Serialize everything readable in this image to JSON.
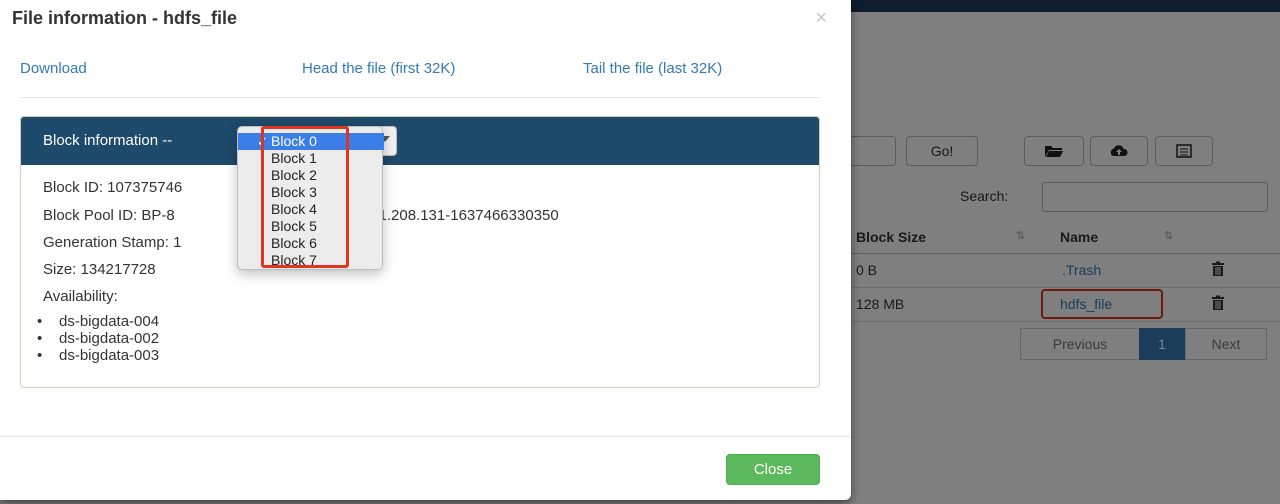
{
  "background": {
    "go_button": "Go!",
    "search_label": "Search:",
    "table": {
      "headers": [
        "Block Size",
        "Name"
      ],
      "rows": [
        {
          "block_size": "0 B",
          "name": ".Trash"
        },
        {
          "block_size": "128 MB",
          "name": "hdfs_file"
        }
      ]
    },
    "pagination": {
      "previous": "Previous",
      "current": "1",
      "next": "Next"
    }
  },
  "modal": {
    "title": "File information - hdfs_file",
    "close_x": "×",
    "links": {
      "download": "Download",
      "head": "Head the file (first 32K)",
      "tail": "Tail the file (last 32K)"
    },
    "panel": {
      "heading": "Block information --",
      "block_id": "Block ID: 107375746",
      "block_pool_id_prefix": "Block Pool ID: BP-8",
      "block_pool_id_suffix": ".21.208.131-1637466330350",
      "generation_stamp": "Generation Stamp: 1",
      "size": "Size: 134217728",
      "availability_label": "Availability:",
      "availability": [
        "ds-bigdata-004",
        "ds-bigdata-002",
        "ds-bigdata-003"
      ]
    },
    "close_button": "Close"
  },
  "dropdown": {
    "check": "✓",
    "selected_index": 0,
    "options": [
      "Block 0",
      "Block 1",
      "Block 2",
      "Block 3",
      "Block 4",
      "Block 5",
      "Block 6",
      "Block 7"
    ]
  },
  "colors": {
    "panel_heading": "#1e4a6b",
    "link": "#337ab7",
    "close_button": "#5cb85c",
    "selected_option": "#3b7ee8",
    "highlight": "#e0351f"
  }
}
